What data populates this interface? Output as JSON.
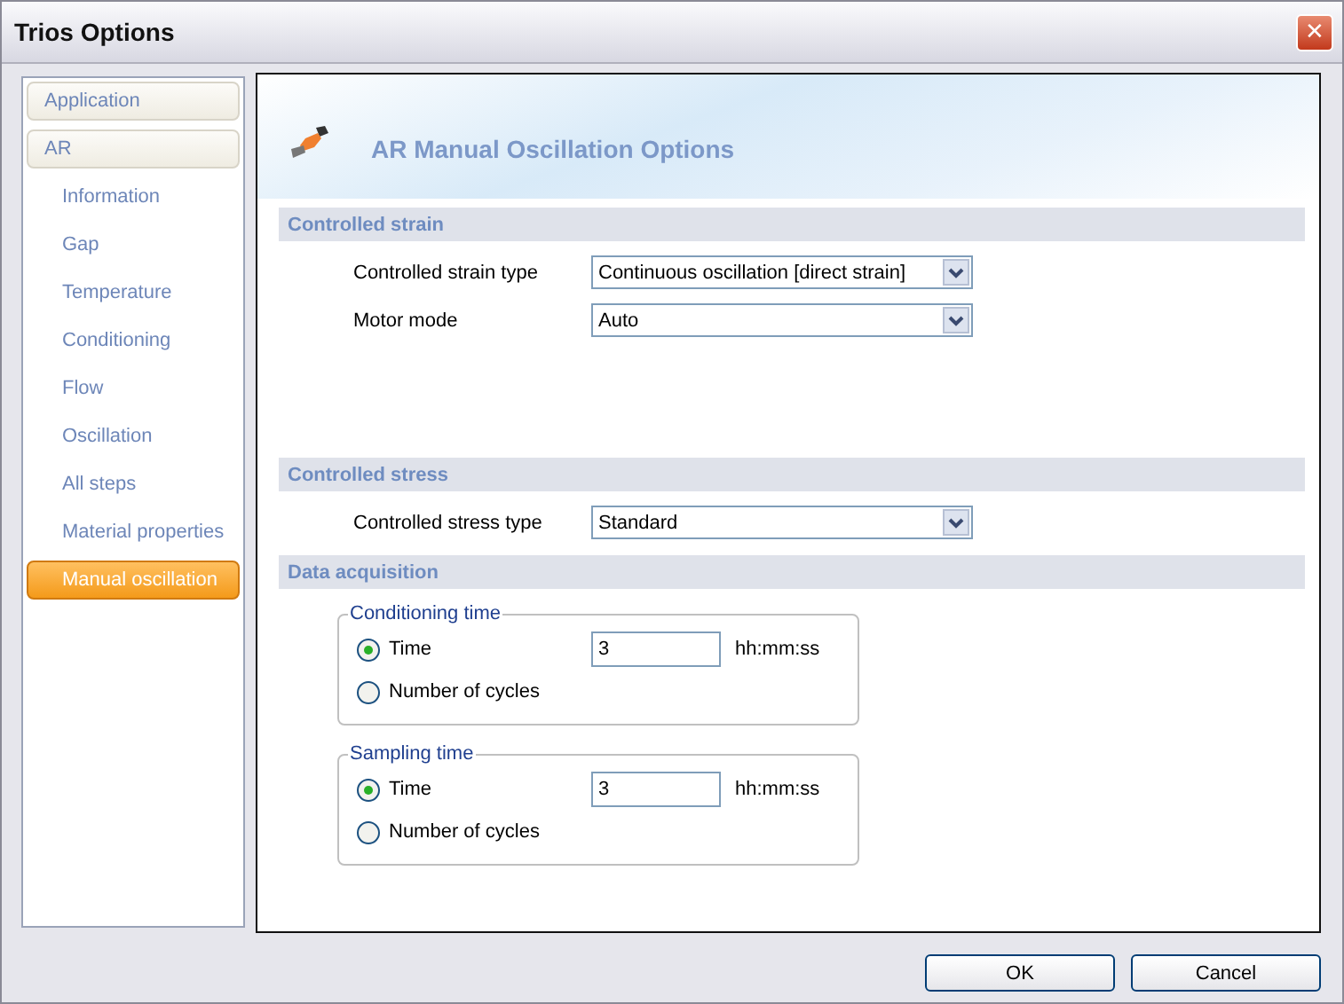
{
  "window": {
    "title": "Trios Options",
    "close": "✕"
  },
  "sidebar": {
    "items": [
      {
        "label": "Application",
        "selected": false
      },
      {
        "label": "AR",
        "selected": false,
        "children": [
          {
            "label": "Information",
            "selected": false
          },
          {
            "label": "Gap",
            "selected": false
          },
          {
            "label": "Temperature",
            "selected": false
          },
          {
            "label": "Conditioning",
            "selected": false
          },
          {
            "label": "Flow",
            "selected": false
          },
          {
            "label": "Oscillation",
            "selected": false
          },
          {
            "label": "All steps",
            "selected": false
          },
          {
            "label": "Material properties",
            "selected": false
          },
          {
            "label": "Manual oscillation",
            "selected": true
          }
        ]
      }
    ]
  },
  "page": {
    "title": "AR Manual Oscillation Options"
  },
  "sections": [
    {
      "kind": "dropdowns",
      "title": "Controlled strain",
      "rows": [
        {
          "label": "Controlled strain type",
          "value": "Continuous oscillation [direct strain]"
        },
        {
          "label": "Motor mode",
          "value": "Auto"
        }
      ]
    },
    {
      "kind": "dropdowns",
      "title": "Controlled stress",
      "rows": [
        {
          "label": "Controlled stress type",
          "value": "Standard"
        }
      ]
    },
    {
      "kind": "groups",
      "title": "Data acquisition",
      "groups": [
        {
          "title": "Conditioning time",
          "options": [
            {
              "label": "Time",
              "selected": true,
              "value": "3",
              "unit": "hh:mm:ss"
            },
            {
              "label": "Number of cycles",
              "selected": false
            }
          ]
        },
        {
          "title": "Sampling time",
          "options": [
            {
              "label": "Time",
              "selected": true,
              "value": "3",
              "unit": "hh:mm:ss"
            },
            {
              "label": "Number of cycles",
              "selected": false
            }
          ]
        }
      ]
    }
  ],
  "buttons": [
    "OK",
    "Cancel"
  ]
}
